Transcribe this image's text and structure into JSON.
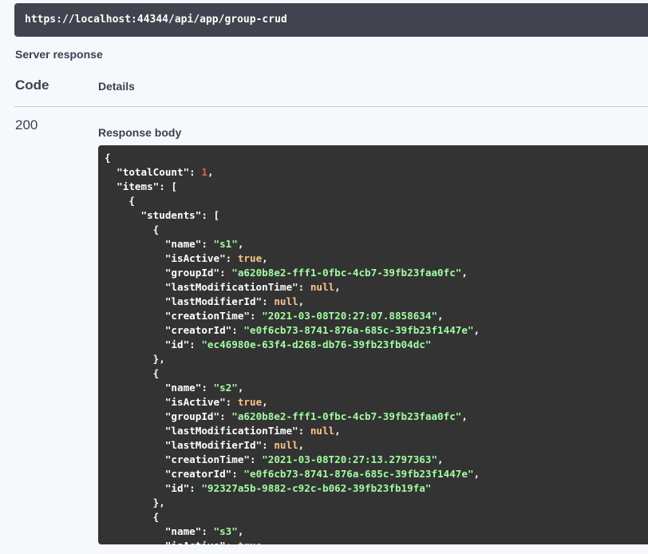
{
  "request_url": "https://localhost:44344/api/app/group-crud",
  "server_response_label": "Server response",
  "table": {
    "code_header": "Code",
    "details_header": "Details",
    "status_code": "200",
    "response_body_label": "Response body"
  },
  "colors": {
    "code_bg": "#333333",
    "url_bar_bg": "#41444e",
    "string": "#a2fca2",
    "number": "#d36363",
    "literal": "#fcc28c"
  },
  "response_lines": [
    [
      {
        "t": "{",
        "c": "p"
      }
    ],
    [
      {
        "t": "  ",
        "c": "p"
      },
      {
        "t": "\"totalCount\"",
        "c": "k"
      },
      {
        "t": ": ",
        "c": "p"
      },
      {
        "t": "1",
        "c": "n"
      },
      {
        "t": ",",
        "c": "p"
      }
    ],
    [
      {
        "t": "  ",
        "c": "p"
      },
      {
        "t": "\"items\"",
        "c": "k"
      },
      {
        "t": ": [",
        "c": "p"
      }
    ],
    [
      {
        "t": "    {",
        "c": "p"
      }
    ],
    [
      {
        "t": "      ",
        "c": "p"
      },
      {
        "t": "\"students\"",
        "c": "k"
      },
      {
        "t": ": [",
        "c": "p"
      }
    ],
    [
      {
        "t": "        {",
        "c": "p"
      }
    ],
    [
      {
        "t": "          ",
        "c": "p"
      },
      {
        "t": "\"name\"",
        "c": "k"
      },
      {
        "t": ": ",
        "c": "p"
      },
      {
        "t": "\"s1\"",
        "c": "s"
      },
      {
        "t": ",",
        "c": "p"
      }
    ],
    [
      {
        "t": "          ",
        "c": "p"
      },
      {
        "t": "\"isActive\"",
        "c": "k"
      },
      {
        "t": ": ",
        "c": "p"
      },
      {
        "t": "true",
        "c": "b"
      },
      {
        "t": ",",
        "c": "p"
      }
    ],
    [
      {
        "t": "          ",
        "c": "p"
      },
      {
        "t": "\"groupId\"",
        "c": "k"
      },
      {
        "t": ": ",
        "c": "p"
      },
      {
        "t": "\"a620b8e2-fff1-0fbc-4cb7-39fb23faa0fc\"",
        "c": "s"
      },
      {
        "t": ",",
        "c": "p"
      }
    ],
    [
      {
        "t": "          ",
        "c": "p"
      },
      {
        "t": "\"lastModificationTime\"",
        "c": "k"
      },
      {
        "t": ": ",
        "c": "p"
      },
      {
        "t": "null",
        "c": "b"
      },
      {
        "t": ",",
        "c": "p"
      }
    ],
    [
      {
        "t": "          ",
        "c": "p"
      },
      {
        "t": "\"lastModifierId\"",
        "c": "k"
      },
      {
        "t": ": ",
        "c": "p"
      },
      {
        "t": "null",
        "c": "b"
      },
      {
        "t": ",",
        "c": "p"
      }
    ],
    [
      {
        "t": "          ",
        "c": "p"
      },
      {
        "t": "\"creationTime\"",
        "c": "k"
      },
      {
        "t": ": ",
        "c": "p"
      },
      {
        "t": "\"2021-03-08T20:27:07.8858634\"",
        "c": "s"
      },
      {
        "t": ",",
        "c": "p"
      }
    ],
    [
      {
        "t": "          ",
        "c": "p"
      },
      {
        "t": "\"creatorId\"",
        "c": "k"
      },
      {
        "t": ": ",
        "c": "p"
      },
      {
        "t": "\"e0f6cb73-8741-876a-685c-39fb23f1447e\"",
        "c": "s"
      },
      {
        "t": ",",
        "c": "p"
      }
    ],
    [
      {
        "t": "          ",
        "c": "p"
      },
      {
        "t": "\"id\"",
        "c": "k"
      },
      {
        "t": ": ",
        "c": "p"
      },
      {
        "t": "\"ec46980e-63f4-d268-db76-39fb23fb04dc\"",
        "c": "s"
      }
    ],
    [
      {
        "t": "        },",
        "c": "p"
      }
    ],
    [
      {
        "t": "        {",
        "c": "p"
      }
    ],
    [
      {
        "t": "          ",
        "c": "p"
      },
      {
        "t": "\"name\"",
        "c": "k"
      },
      {
        "t": ": ",
        "c": "p"
      },
      {
        "t": "\"s2\"",
        "c": "s"
      },
      {
        "t": ",",
        "c": "p"
      }
    ],
    [
      {
        "t": "          ",
        "c": "p"
      },
      {
        "t": "\"isActive\"",
        "c": "k"
      },
      {
        "t": ": ",
        "c": "p"
      },
      {
        "t": "true",
        "c": "b"
      },
      {
        "t": ",",
        "c": "p"
      }
    ],
    [
      {
        "t": "          ",
        "c": "p"
      },
      {
        "t": "\"groupId\"",
        "c": "k"
      },
      {
        "t": ": ",
        "c": "p"
      },
      {
        "t": "\"a620b8e2-fff1-0fbc-4cb7-39fb23faa0fc\"",
        "c": "s"
      },
      {
        "t": ",",
        "c": "p"
      }
    ],
    [
      {
        "t": "          ",
        "c": "p"
      },
      {
        "t": "\"lastModificationTime\"",
        "c": "k"
      },
      {
        "t": ": ",
        "c": "p"
      },
      {
        "t": "null",
        "c": "b"
      },
      {
        "t": ",",
        "c": "p"
      }
    ],
    [
      {
        "t": "          ",
        "c": "p"
      },
      {
        "t": "\"lastModifierId\"",
        "c": "k"
      },
      {
        "t": ": ",
        "c": "p"
      },
      {
        "t": "null",
        "c": "b"
      },
      {
        "t": ",",
        "c": "p"
      }
    ],
    [
      {
        "t": "          ",
        "c": "p"
      },
      {
        "t": "\"creationTime\"",
        "c": "k"
      },
      {
        "t": ": ",
        "c": "p"
      },
      {
        "t": "\"2021-03-08T20:27:13.2797363\"",
        "c": "s"
      },
      {
        "t": ",",
        "c": "p"
      }
    ],
    [
      {
        "t": "          ",
        "c": "p"
      },
      {
        "t": "\"creatorId\"",
        "c": "k"
      },
      {
        "t": ": ",
        "c": "p"
      },
      {
        "t": "\"e0f6cb73-8741-876a-685c-39fb23f1447e\"",
        "c": "s"
      },
      {
        "t": ",",
        "c": "p"
      }
    ],
    [
      {
        "t": "          ",
        "c": "p"
      },
      {
        "t": "\"id\"",
        "c": "k"
      },
      {
        "t": ": ",
        "c": "p"
      },
      {
        "t": "\"92327a5b-9882-c92c-b062-39fb23fb19fa\"",
        "c": "s"
      }
    ],
    [
      {
        "t": "        },",
        "c": "p"
      }
    ],
    [
      {
        "t": "        {",
        "c": "p"
      }
    ],
    [
      {
        "t": "          ",
        "c": "p"
      },
      {
        "t": "\"name\"",
        "c": "k"
      },
      {
        "t": ": ",
        "c": "p"
      },
      {
        "t": "\"s3\"",
        "c": "s"
      },
      {
        "t": ",",
        "c": "p"
      }
    ],
    [
      {
        "t": "          ",
        "c": "p"
      },
      {
        "t": "\"isActive\"",
        "c": "k"
      },
      {
        "t": ": ",
        "c": "p"
      },
      {
        "t": "true",
        "c": "b"
      },
      {
        "t": ",",
        "c": "p"
      }
    ]
  ]
}
